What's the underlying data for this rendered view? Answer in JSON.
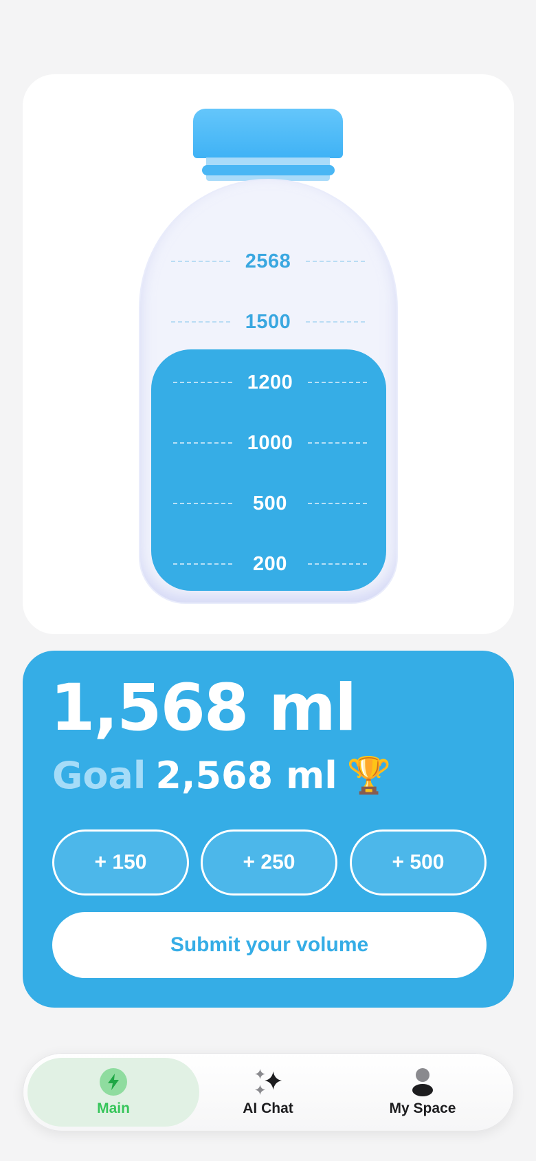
{
  "bottle": {
    "marks": [
      "2568",
      "1500",
      "1200",
      "1000",
      "500",
      "200"
    ],
    "fill_level_ml": 1568
  },
  "stats": {
    "amount": "1,568 ml",
    "goal_label": "Goal",
    "goal_value": "2,568 ml",
    "goal_icon": "🏆"
  },
  "quick_add": [
    "+ 150",
    "+ 250",
    "+ 500"
  ],
  "submit_label": "Submit your volume",
  "tabs": [
    {
      "label": "Main",
      "icon": "lightning-icon",
      "active": true
    },
    {
      "label": "AI Chat",
      "icon": "sparkle-icon",
      "active": false
    },
    {
      "label": "My Space",
      "icon": "person-icon",
      "active": false
    }
  ],
  "colors": {
    "accent": "#35ade6",
    "active_tab": "#36c55a",
    "background": "#f4f4f5"
  }
}
